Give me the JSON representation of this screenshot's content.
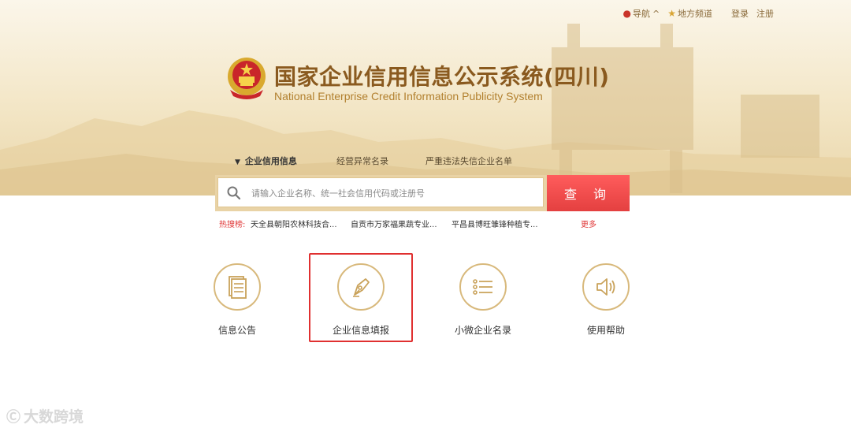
{
  "top_nav": {
    "nav": "导航",
    "regional": "地方频道",
    "login": "登录",
    "register": "注册"
  },
  "site": {
    "title_cn": "国家企业信用信息公示系统(四川)",
    "title_en": "National Enterprise Credit Information Publicity System"
  },
  "tabs": [
    "企业信用信息",
    "经营异常名录",
    "严重违法失信企业名单"
  ],
  "search": {
    "placeholder": "请输入企业名称、统一社会信用代码或注册号",
    "button": "查 询"
  },
  "hot": {
    "label": "热搜榜:",
    "items": [
      "天全县朝阳农林科技合...",
      "自贡市万家福果蔬专业...",
      "平昌县博旺雏锋种植专..."
    ],
    "more": "更多"
  },
  "features": [
    {
      "label": "信息公告",
      "icon": "document-icon"
    },
    {
      "label": "企业信息填报",
      "icon": "pen-nib-icon"
    },
    {
      "label": "小微企业名录",
      "icon": "list-icon"
    },
    {
      "label": "使用帮助",
      "icon": "speaker-icon"
    }
  ],
  "watermark": "大数跨境",
  "colors": {
    "gold": "#d8b97c",
    "title": "#8a5a1f",
    "accent_red": "#e44040"
  }
}
